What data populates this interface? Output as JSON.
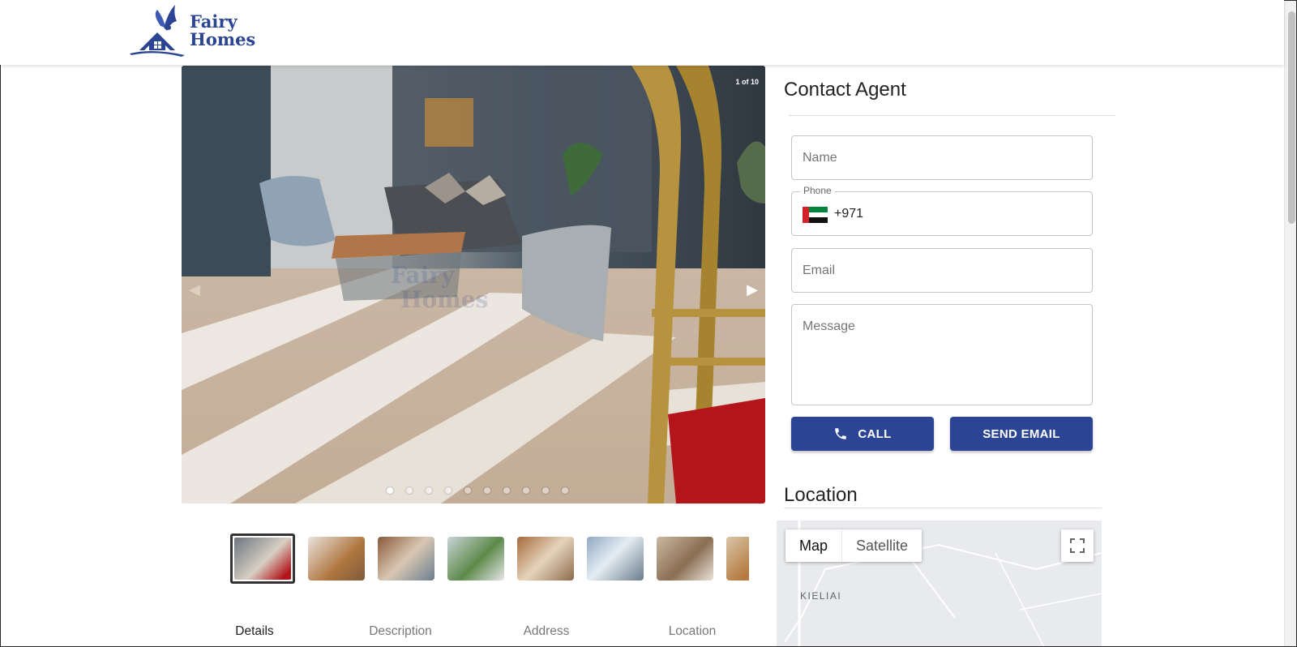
{
  "brand": {
    "name_line1": "Fairy",
    "name_line2": "Homes"
  },
  "gallery": {
    "counter": "1 of 10",
    "dot_count": 10,
    "active_index": 0,
    "thumbnail_count": 8,
    "prev_icon": "chevron-left-icon",
    "next_icon": "chevron-right-icon"
  },
  "tabs": [
    {
      "label": "Details"
    },
    {
      "label": "Description"
    },
    {
      "label": "Address"
    },
    {
      "label": "Location"
    }
  ],
  "contact": {
    "title": "Contact Agent",
    "name_placeholder": "Name",
    "phone_label": "Phone",
    "phone_value": "+971",
    "email_placeholder": "Email",
    "message_placeholder": "Message",
    "call_label": "CALL",
    "call_icon": "phone-icon",
    "send_label": "SEND EMAIL"
  },
  "location": {
    "title": "Location",
    "map_label": "Map",
    "satellite_label": "Satellite",
    "place_label": "KIELIAI",
    "fullscreen_icon": "fullscreen-icon"
  },
  "colors": {
    "brand": "#2b4594",
    "flag_red": "#d3232a",
    "flag_green": "#00843d",
    "flag_black": "#111111"
  }
}
